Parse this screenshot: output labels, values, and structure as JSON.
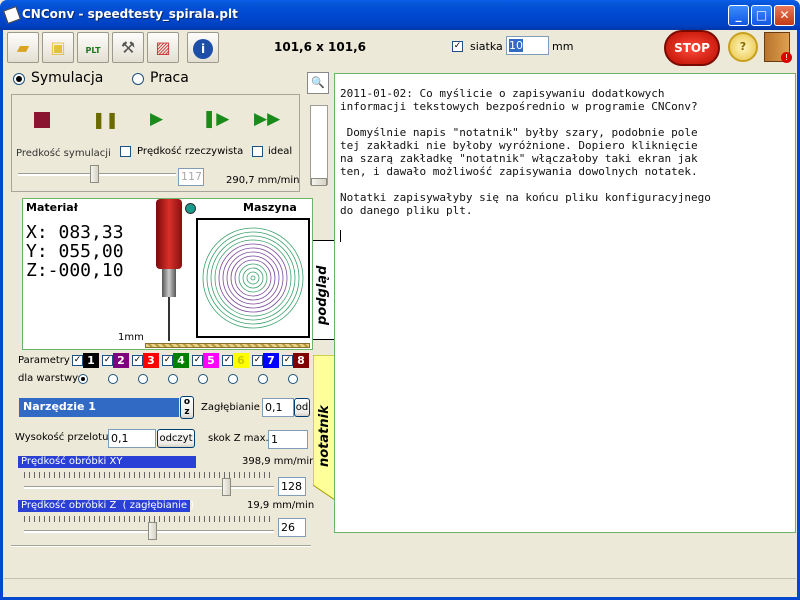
{
  "window": {
    "title": "CNConv - speedtesty_spirala.plt",
    "minimize": "_",
    "maximize": "□",
    "close": "✕"
  },
  "toolbar": {
    "size_label": "101,6 x 101,6",
    "grid_label": "siatka",
    "grid_value": "10",
    "grid_unit": "mm",
    "stop_label": "STOP",
    "help_label": "?",
    "plt_label": "PLT"
  },
  "mode": {
    "sim_label": "Symulacja",
    "work_label": "Praca"
  },
  "sim": {
    "speed_label": "Predkość symulacji",
    "real_speed_label": "Prędkość rzeczywista",
    "ideal_label": "ideal",
    "speed_value": "117",
    "speed_mm": "290,7 mm/min"
  },
  "preview": {
    "material_label": "Materiał",
    "machine_label": "Maszyna",
    "x": "X: 083,33",
    "y": "Y: 055,00",
    "z": "Z:-000,10",
    "scale_label": "1mm",
    "tab_label": "podgląd"
  },
  "params": {
    "label": "Parametry",
    "layers_label": "dla warstwy:",
    "layers": [
      "1",
      "2",
      "3",
      "4",
      "5",
      "6",
      "7",
      "8"
    ],
    "layer_colors": [
      "#000000",
      "#800080",
      "#ff0000",
      "#008000",
      "#ff00ff",
      "#ffff00",
      "#0000ff",
      "#800000"
    ]
  },
  "tool": {
    "name": "Narzędzie 1",
    "oz_o": "o",
    "oz_z": "z",
    "depth_label": "Zagłębianie",
    "depth_value": "0,1",
    "depth_btn": "od",
    "height_label": "Wysokość przelotu",
    "height_value": "0,1",
    "read_btn": "odczyt",
    "step_label": "skok Z max.",
    "step_value": "1"
  },
  "speeds": {
    "xy_label": "Prędkość obróbki XY",
    "xy_value": "398,9 mm/min",
    "xy_num": "128",
    "z_label": "Prędkość obróbki Z  ( zagłębianie )",
    "z_value": "19,9 mm/min",
    "z_num": "26"
  },
  "notes": {
    "tab_label": "notatnik",
    "line1": "2011-01-02: Co myślicie o zapisywaniu dodatkowych",
    "line2": "informacji tekstowych bezpośrednio w programie CNConv?",
    "line3": " Domyślnie napis \"notatnik\" byłby szary, podobnie pole",
    "line4": "tej zakładki nie byłoby wyróżnione. Dopiero kliknięcie",
    "line5": "na szarą zakładkę \"notatnik\" włączałoby taki ekran jak",
    "line6": "ten, i dawało możliwość zapisywania dowolnych notatek.",
    "line7": "Notatki zapisywałyby się na końcu pliku konfiguracyjnego",
    "line8": "do danego pliku plt."
  }
}
